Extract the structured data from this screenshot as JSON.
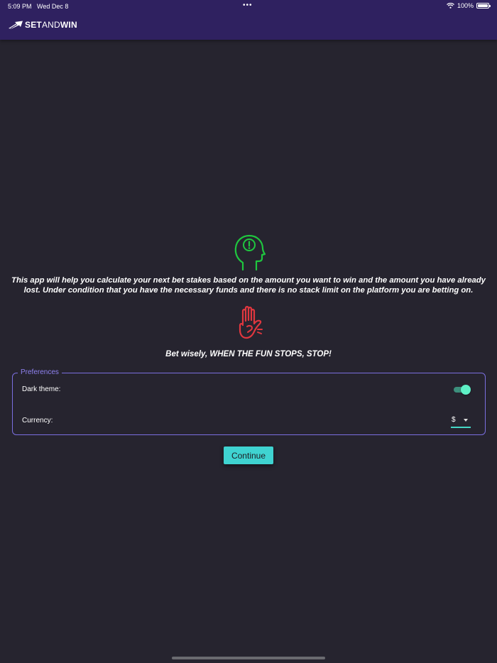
{
  "status_bar": {
    "time": "5:09 PM",
    "date": "Wed Dec 8",
    "dots": "•••",
    "battery_percent": "100%",
    "wifi_icon": "wifi-icon",
    "battery_icon": "battery-icon"
  },
  "header": {
    "logo_bold_1": "SET",
    "logo_thin": "AND",
    "logo_bold_2": "WIN",
    "logo_icon": "arrow-logo-icon",
    "background_color": "#2f2160"
  },
  "intro": {
    "icon": "head-exclamation-icon",
    "icon_color": "#1fc63f",
    "text": "This app will help you calculate your next bet stakes based on the amount you want to win and the amount you have already lost. Under condition that you have the necessary funds and there is no stack limit on the platform you are betting on."
  },
  "warning": {
    "icon": "stop-hand-icon",
    "icon_color": "#e0373f",
    "text": "Bet wisely, WHEN THE FUN STOPS, STOP!"
  },
  "preferences": {
    "legend": "Preferences",
    "dark_theme_label": "Dark theme:",
    "dark_theme_on": true,
    "currency_label": "Currency:",
    "currency_value": "$",
    "accent_color": "#7b6fe0"
  },
  "continue_label": "Continue",
  "colors": {
    "background": "#26242f",
    "button": "#3fd3d1",
    "toggle_thumb": "#5ef0c6"
  }
}
